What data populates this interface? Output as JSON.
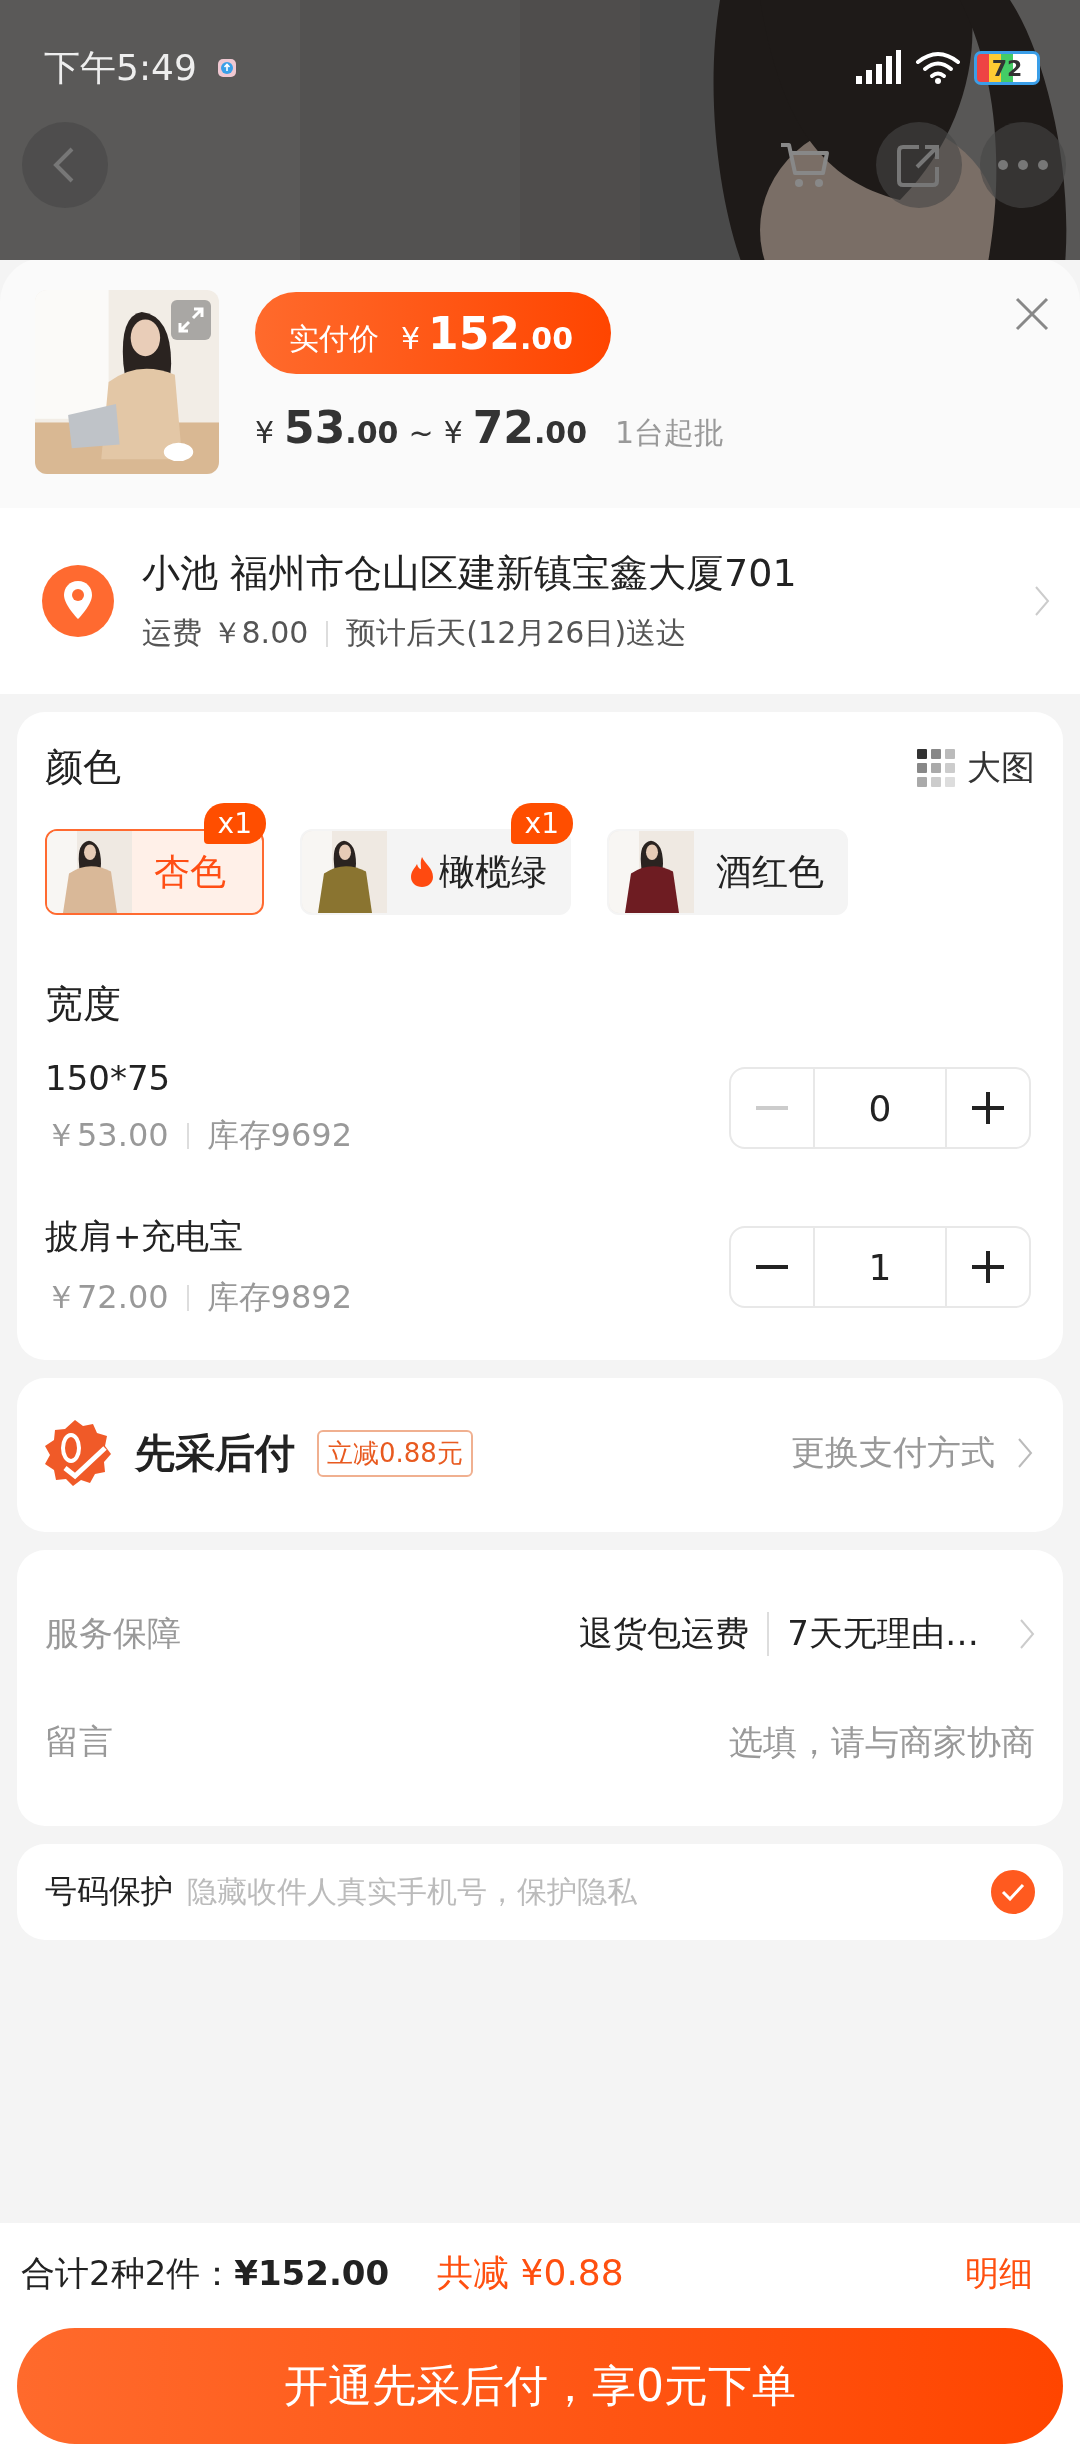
{
  "status_bar": {
    "time": "下午5:49",
    "battery": "72"
  },
  "product": {
    "pay_label": "实付价",
    "pay_price": {
      "currency": "¥",
      "integer": "152",
      "decimal": ".00"
    },
    "range_min": {
      "currency": "¥",
      "integer": "53",
      "decimal": ".00"
    },
    "range_sep": "~",
    "range_max": {
      "currency": "¥",
      "integer": "72",
      "decimal": ".00"
    },
    "min_order": "1台起批"
  },
  "address": {
    "recipient": "小池 福州市仓山区建新镇宝鑫大厦701",
    "freight": "运费 ￥8.00",
    "eta": "预计后天(12月26日)送达"
  },
  "color": {
    "title": "颜色",
    "view_toggle": "大图",
    "options": [
      {
        "label": "杏色",
        "selected": true,
        "badge": "x1",
        "hot": false
      },
      {
        "label": "橄榄绿",
        "selected": false,
        "badge": "x1",
        "hot": true
      },
      {
        "label": "酒红色",
        "selected": false,
        "hot": false
      }
    ]
  },
  "width": {
    "title": "宽度",
    "skus": [
      {
        "name": "150*75",
        "price": "￥53.00",
        "stock": "库存9692",
        "quantity": "0",
        "minus_disabled": true
      },
      {
        "name": "披肩+充电宝",
        "price": "￥72.00",
        "stock": "库存9892",
        "quantity": "1",
        "minus_disabled": false
      }
    ]
  },
  "payment": {
    "title": "先采后付",
    "tag": "立减0.88元",
    "change": "更换支付方式"
  },
  "service": {
    "label": "服务保障",
    "items": [
      "退货包运费",
      "7天无理由…"
    ]
  },
  "message": {
    "label": "留言",
    "placeholder": "选填，请与商家协商"
  },
  "privacy": {
    "label": "号码保护",
    "hint": "隐藏收件人真实手机号，保护隐私",
    "checked": true
  },
  "footer": {
    "total_label": "合计2种2件：",
    "total": "¥152.00",
    "discount_label": "共减",
    "discount": "¥0.88",
    "detail": "明细",
    "cta": "开通先采后付，享0元下单"
  }
}
